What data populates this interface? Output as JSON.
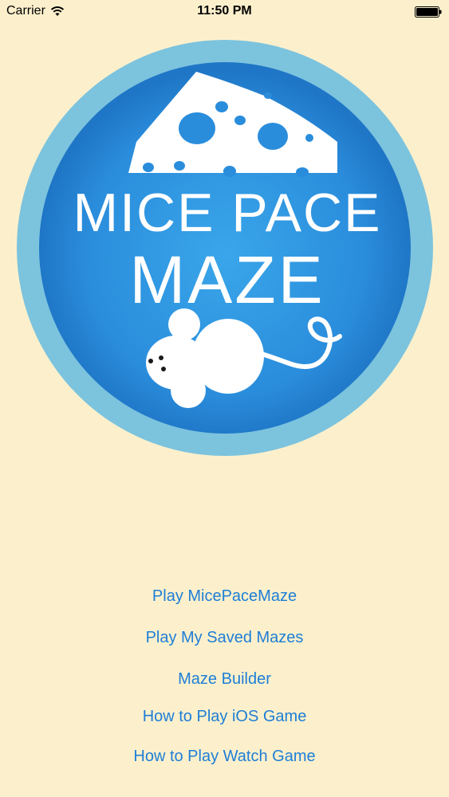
{
  "status_bar": {
    "carrier": "Carrier",
    "time": "11:50 PM",
    "wifi_icon": "wifi-icon",
    "battery_icon": "battery-icon"
  },
  "logo": {
    "line1": "MICE PACE",
    "line2": "MAZE",
    "colors": {
      "outer_ring": "#7cc3de",
      "inner_blue": "#1f76c6",
      "highlight_blue": "#3aa6ea",
      "cheese_and_mouse": "#ffffff"
    }
  },
  "menu": {
    "items": [
      {
        "label": "Play MicePaceMaze"
      },
      {
        "label": "Play My Saved Mazes"
      },
      {
        "label": "Maze Builder"
      },
      {
        "label": "How to Play iOS Game"
      },
      {
        "label": "How to Play Watch Game"
      }
    ]
  },
  "colors": {
    "background": "#fcf0cc",
    "link": "#1e7ed6"
  }
}
